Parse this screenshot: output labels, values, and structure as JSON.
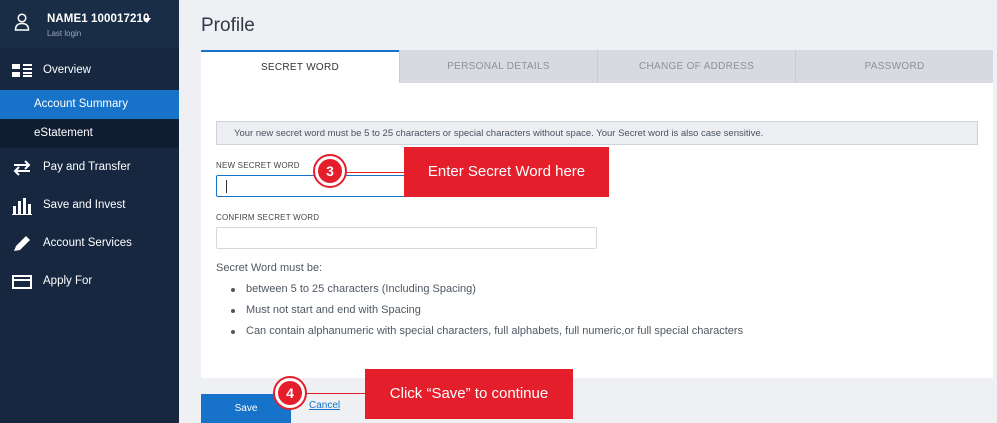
{
  "user": {
    "name": "NAME1 100017210",
    "last_login": "Last login"
  },
  "sidebar": {
    "items": [
      {
        "label": "Overview",
        "icon": "overview-icon"
      },
      {
        "label": "Account Summary"
      },
      {
        "label": "eStatement"
      },
      {
        "label": "Pay and Transfer",
        "icon": "transfer-icon"
      },
      {
        "label": "Save and Invest",
        "icon": "bar-chart-icon"
      },
      {
        "label": "Account Services",
        "icon": "pencil-icon"
      },
      {
        "label": "Apply For",
        "icon": "card-icon"
      }
    ]
  },
  "main": {
    "title": "Profile",
    "tabs": [
      {
        "label": "SECRET WORD",
        "active": true
      },
      {
        "label": "PERSONAL DETAILS",
        "active": false
      },
      {
        "label": "CHANGE OF ADDRESS",
        "active": false
      },
      {
        "label": "PASSWORD",
        "active": false
      }
    ],
    "notice": "Your new secret word must be 5 to 25 characters or special characters without space. Your Secret word is also case sensitive.",
    "fields": {
      "new_secret_word": {
        "label": "NEW SECRET WORD",
        "value": ""
      },
      "confirm_secret_word": {
        "label": "CONFIRM SECRET WORD",
        "value": ""
      }
    },
    "rules_title": "Secret Word must be:",
    "rules": [
      "between 5 to 25 characters (Including Spacing)",
      "Must not start and end with Spacing",
      "Can contain alphanumeric with special characters, full alphabets, full numeric,or full special characters"
    ],
    "save_label": "Save",
    "cancel_label": "Cancel"
  },
  "annotations": {
    "step3": {
      "number": "3",
      "text": "Enter Secret Word here"
    },
    "step4": {
      "number": "4",
      "text": "Click “Save” to continue"
    }
  },
  "colors": {
    "sidebar_bg": "#16273f",
    "accent_blue": "#1673c9",
    "callout_red": "#e41e2b"
  }
}
